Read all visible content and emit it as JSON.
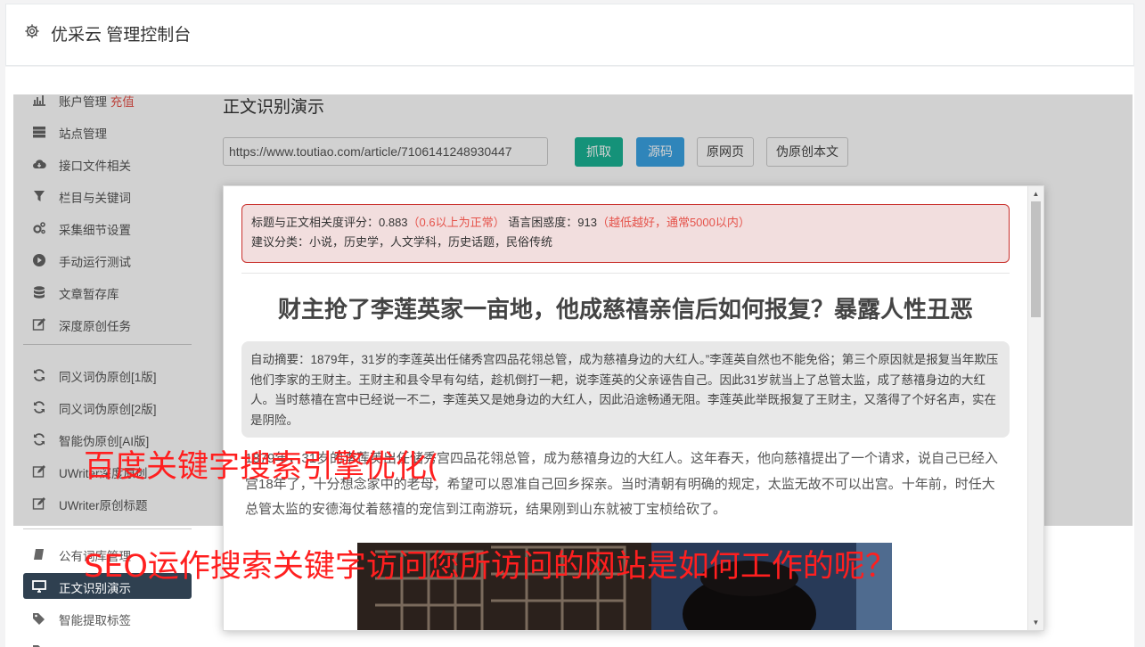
{
  "header": {
    "title": "优采云 管理控制台",
    "icon": "gear-icon"
  },
  "sidebar": {
    "items": [
      {
        "label": "账户管理",
        "badge": "充值",
        "icon": "bar-chart-icon"
      },
      {
        "label": "站点管理",
        "icon": "server-icon"
      },
      {
        "label": "接口文件相关",
        "icon": "cloud-download-icon"
      },
      {
        "label": "栏目与关键词",
        "icon": "filter-icon"
      },
      {
        "label": "采集细节设置",
        "icon": "cogs-icon"
      },
      {
        "label": "手动运行测试",
        "icon": "play-circle-icon"
      },
      {
        "label": "文章暂存库",
        "icon": "database-icon"
      },
      {
        "label": "深度原创任务",
        "icon": "edit-icon"
      },
      {
        "label": "同义词伪原创[1版]",
        "icon": "refresh-icon"
      },
      {
        "label": "同义词伪原创[2版]",
        "icon": "refresh-icon"
      },
      {
        "label": "智能伪原创[AI版]",
        "icon": "refresh-icon"
      },
      {
        "label": "UWriter深度原创",
        "icon": "edit-icon"
      },
      {
        "label": "UWriter原创标题",
        "icon": "edit-icon"
      },
      {
        "label": "公有词库管理",
        "icon": "book-icon"
      },
      {
        "label": "正文识别演示",
        "icon": "desktop-icon",
        "active": true
      },
      {
        "label": "智能提取标签",
        "icon": "tag-icon"
      },
      {
        "label": "...",
        "icon": "tag-icon"
      }
    ]
  },
  "main": {
    "title": "正文识别演示",
    "url_value": "https://www.toutiao.com/article/7106141248930447",
    "buttons": {
      "fetch": "抓取",
      "source": "源码",
      "original": "原网页",
      "pseudo": "伪原创本文"
    }
  },
  "modal": {
    "score_label": "标题与正文相关度评分：0.883",
    "score_note": "（0.6以上为正常）",
    "ppl_label": "语言困惑度：913",
    "ppl_note": "（越低越好，通常5000以内）",
    "category": "建议分类：小说，历史学，人文学科，历史话题，民俗传统",
    "article_title": "财主抢了李莲英家一亩地，他成慈禧亲信后如何报复？暴露人性丑恶",
    "summary": "自动摘要：1879年，31岁的李莲英出任储秀宫四品花翎总管，成为慈禧身边的大红人。”李莲英自然也不能免俗；第三个原因就是报复当年欺压他们李家的王财主。王财主和县令早有勾结，趁机倒打一耙，说李莲英的父亲诬告自己。因此31岁就当上了总管太监，成了慈禧身边的大红人。当时慈禧在宫中已经说一不二，李莲英又是她身边的大红人，因此沿途畅通无阻。李莲英此举既报复了王财主，又落得了个好名声，实在是阴险。",
    "body": "1879年，31岁的李莲英出任储秀宫四品花翎总管，成为慈禧身边的大红人。这年春天，他向慈禧提出了一个请求，说自己已经入宫18年了，十分想念家中的老母，希望可以恩准自己回乡探亲。当时清朝有明确的规定，太监无故不可以出宫。十年前，时任大总管太监的安德海仗着慈禧的宠信到江南游玩，结果刚到山东就被丁宝桢给砍了。"
  },
  "watermark": {
    "line1": "百度关键字搜索引擎优化(",
    "line2": "SEO运作搜索关键字访问您所访问的网站是如何工作的呢？"
  },
  "colors": {
    "sidebar_active": "#2f4050",
    "green": "#1ab394",
    "blue": "#3aa3e3",
    "alert_bg": "#f2dede",
    "watermark": "#ff1f1f"
  }
}
